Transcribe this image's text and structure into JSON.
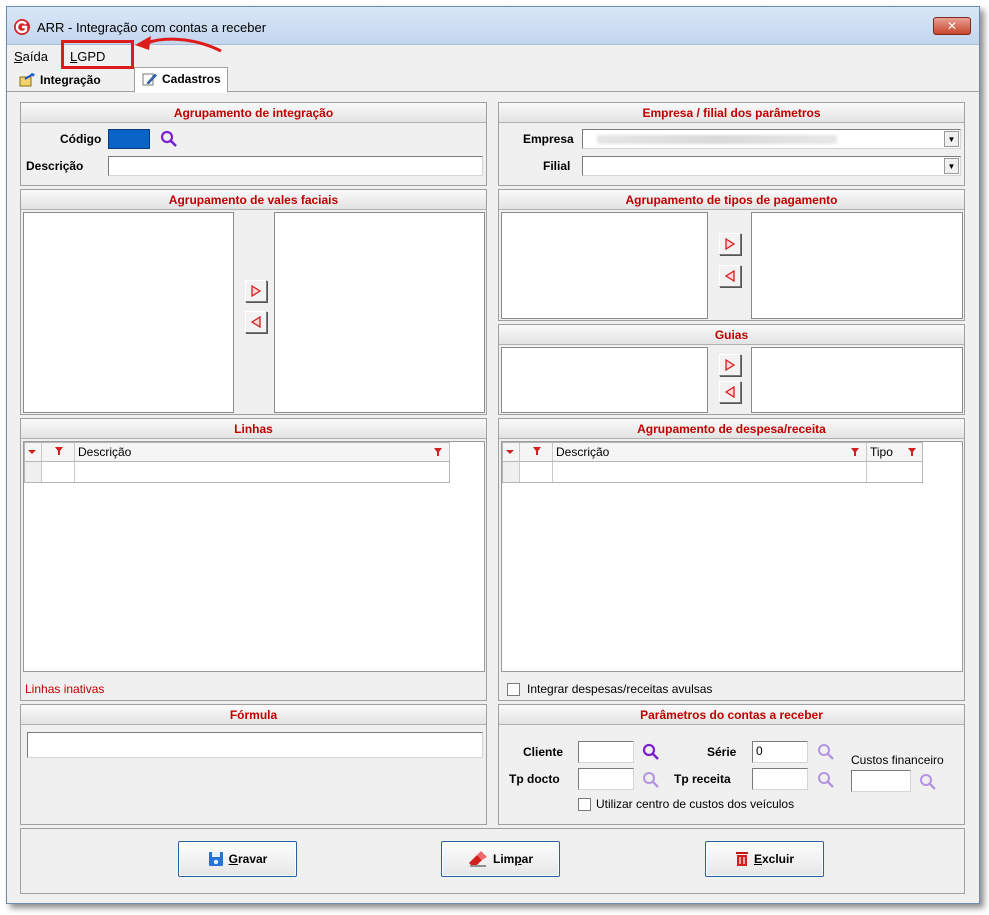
{
  "window": {
    "title": "ARR - Integração com contas a receber",
    "close_label": "✕"
  },
  "menu": {
    "items": [
      {
        "label_under": "S",
        "label_rest": "aída"
      },
      {
        "label_under": "L",
        "label_rest": "GPD"
      }
    ]
  },
  "tabs": [
    {
      "label": "Integração"
    },
    {
      "label": "Cadastros"
    }
  ],
  "agrupamento_integracao": {
    "header": "Agrupamento de integração",
    "codigo_label": "Código",
    "descricao_label": "Descrição",
    "codigo_value": "",
    "descricao_value": ""
  },
  "empresa_filial": {
    "header": "Empresa / filial  dos parâmetros",
    "empresa_label": "Empresa",
    "filial_label": "Filial",
    "filial_value": ""
  },
  "vales_faciais": {
    "header": "Agrupamento de vales faciais"
  },
  "tipos_pagamento": {
    "header": "Agrupamento de tipos de pagamento"
  },
  "guias": {
    "header": "Guias"
  },
  "linhas": {
    "header": "Linhas",
    "col_descricao": "Descrição",
    "inactive_text": "Linhas inativas"
  },
  "despesa_receita": {
    "header": "Agrupamento de despesa/receita",
    "col_descricao": "Descrição",
    "col_tipo": "Tipo",
    "checkbox_label": "Integrar despesas/receitas avulsas"
  },
  "formula": {
    "header": "Fórmula",
    "value": ""
  },
  "parametros": {
    "header": "Parâmetros do contas a receber",
    "cliente_label": "Cliente",
    "serie_label": "Série",
    "serie_value": "0",
    "custos_label": "Custos financeiro",
    "tp_docto_label": "Tp docto",
    "tp_receita_label": "Tp receita",
    "centro_custos_label": "Utilizar centro de custos dos veículos"
  },
  "buttons": {
    "gravar_under": "G",
    "gravar_rest": "ravar",
    "limpar_pre": "Lim",
    "limpar_under": "p",
    "limpar_rest": "ar",
    "excluir_under": "E",
    "excluir_rest": "xcluir"
  },
  "colors": {
    "header_text": "#c00000",
    "accent_blue": "#0a64c8",
    "search_purple": "#7b1fd0",
    "highlight_red": "#e01b1b"
  }
}
